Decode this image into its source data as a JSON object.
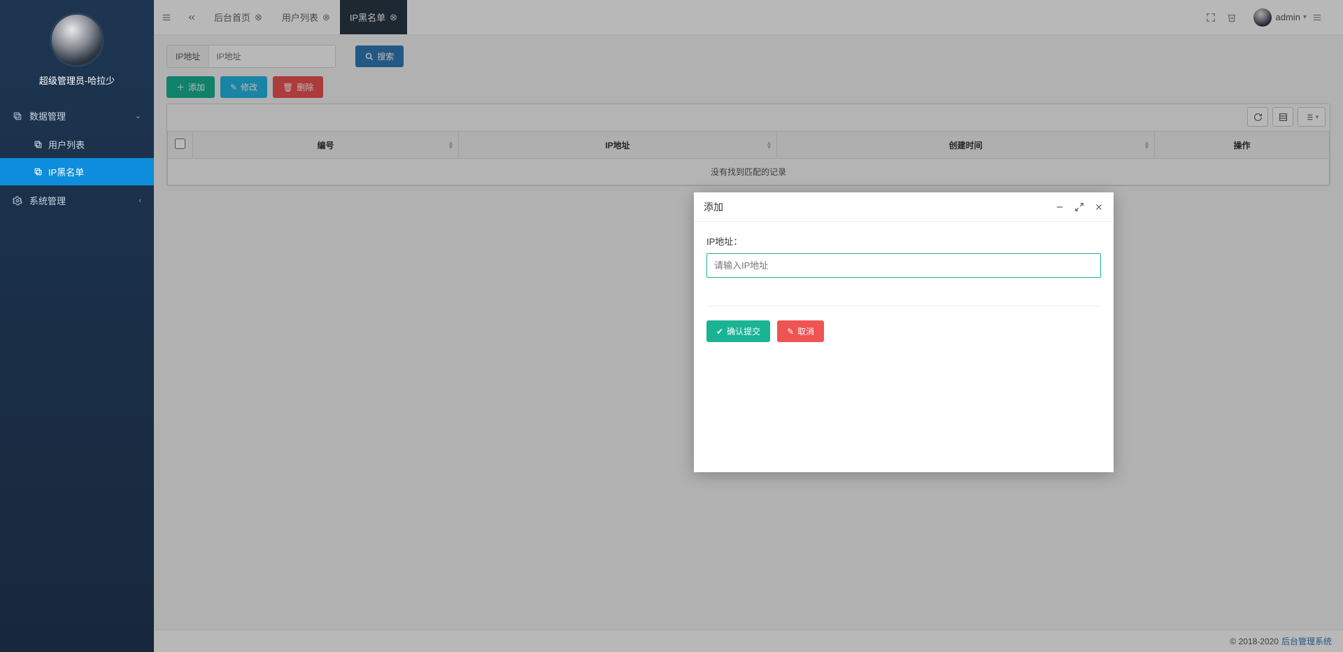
{
  "sidebar": {
    "user_name": "超级管理员-哈拉少",
    "menu1": {
      "label": "数据管理",
      "sub": [
        "用户列表",
        "IP黑名单"
      ]
    },
    "menu2": {
      "label": "系统管理"
    }
  },
  "tabs": [
    "后台首页",
    "用户列表",
    "IP黑名单"
  ],
  "header": {
    "username": "admin"
  },
  "search": {
    "addon": "IP地址",
    "placeholder": "IP地址",
    "button": "搜索"
  },
  "buttons": {
    "add": "添加",
    "edit": "修改",
    "delete": "删除"
  },
  "table": {
    "columns": [
      "编号",
      "IP地址",
      "创建时间",
      "操作"
    ],
    "empty": "没有找到匹配的记录"
  },
  "footer": {
    "copyright": "© 2018-2020",
    "link": "后台管理系统"
  },
  "modal": {
    "title": "添加",
    "field_label": "IP地址：",
    "placeholder": "请输入IP地址",
    "submit": "确认提交",
    "cancel": "取消"
  }
}
